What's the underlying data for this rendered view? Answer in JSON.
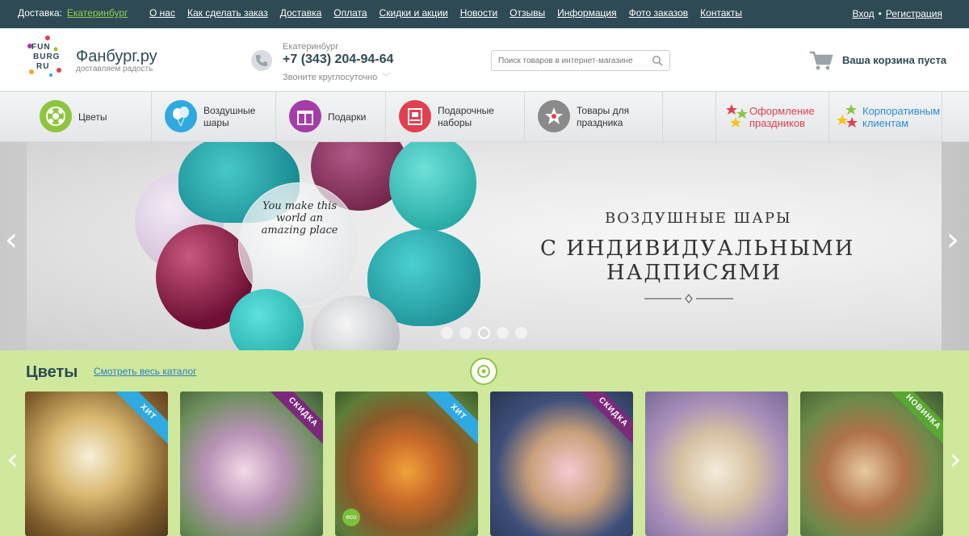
{
  "topbar": {
    "delivery_label": "Доставка:",
    "city": "Екатеринбург",
    "nav": [
      "О нас",
      "Как сделать заказ",
      "Доставка",
      "Оплата",
      "Скидки и акции",
      "Новости",
      "Отзывы",
      "Информация",
      "Фото заказов",
      "Контакты"
    ],
    "login": "Вход",
    "separator": "•",
    "register": "Регистрация"
  },
  "header": {
    "logo_lines": [
      "FUN",
      "BURG",
      "RU"
    ],
    "brand": "Фанбург.ру",
    "slogan": "доставляем радость",
    "city": "Екатеринбург",
    "phone": "+7 (343) 204-94-64",
    "hours": "Звоните круглосуточно",
    "search_placeholder": "Поиск товаров в интернет-магазине",
    "cart": "Ваша корзина пуста"
  },
  "categories": [
    {
      "label": "Цветы",
      "icon": "flower-icon",
      "color": "#8cc63f"
    },
    {
      "label": "Воздушные шары",
      "icon": "balloons-icon",
      "color": "#2fa9e0"
    },
    {
      "label": "Подарки",
      "icon": "gift-icon",
      "color": "#a53ca8"
    },
    {
      "label": "Подарочные наборы",
      "icon": "gift-set-icon",
      "color": "#e0404f"
    },
    {
      "label": "Товары для праздника",
      "icon": "party-goods-icon",
      "color": "#8a8a8a"
    },
    {
      "label": "Оформление праздников",
      "icon": "stars-icon",
      "color": "#e0404f"
    },
    {
      "label": "Корпоративным клиентам",
      "icon": "stars-icon",
      "color": "#2fa9e0"
    }
  ],
  "hero": {
    "line1": "ВОЗДУШНЫЕ ШАРЫ",
    "line2": "С ИНДИВИДУАЛЬНЫМИ",
    "line3": "НАДПИСЯМИ",
    "balloon_text": "You make this world an amazing place",
    "slide_count": 5,
    "active_slide": 3
  },
  "section": {
    "title": "Цветы",
    "link": "Смотреть весь каталог",
    "products": [
      {
        "badge": "ХИТ",
        "badge_type": "hit"
      },
      {
        "badge": "СКИДКА",
        "badge_type": "sale"
      },
      {
        "badge": "ХИТ",
        "badge_type": "hit",
        "eco": "eco"
      },
      {
        "badge": "СКИДКА",
        "badge_type": "sale"
      },
      {
        "badge": "",
        "badge_type": ""
      },
      {
        "badge": "НОВИНКА",
        "badge_type": "new"
      }
    ]
  }
}
